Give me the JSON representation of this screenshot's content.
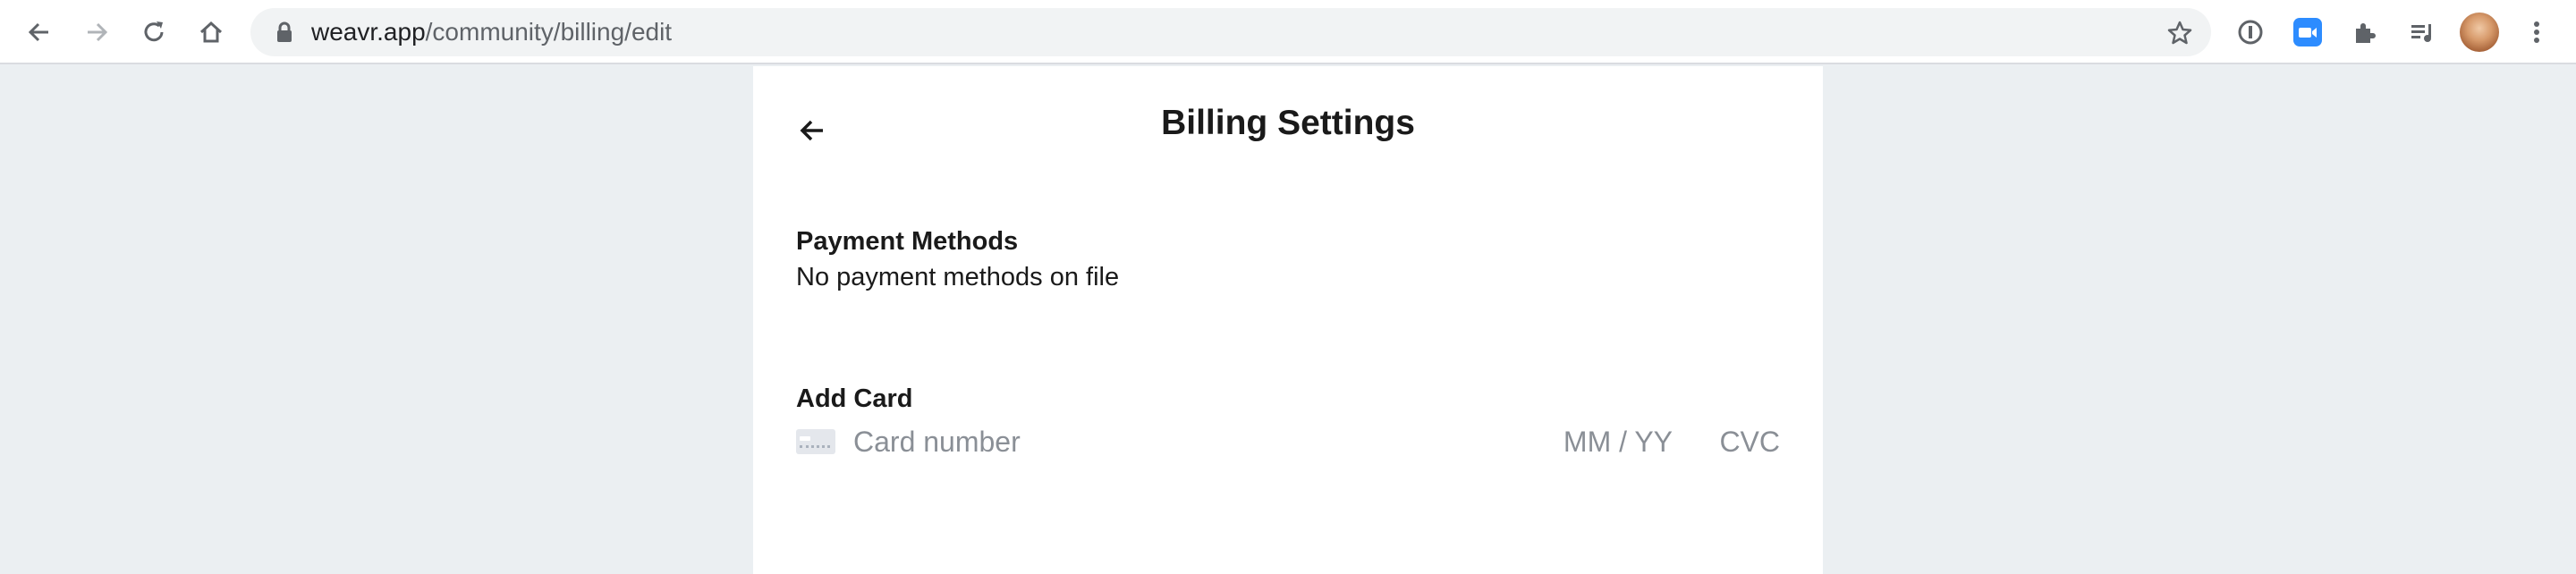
{
  "browser": {
    "url_host": "weavr.app",
    "url_path": "/community/billing/edit",
    "icons": [
      "back-icon",
      "forward-icon",
      "reload-icon",
      "home-icon",
      "lock-icon",
      "star-icon",
      "password-manager-icon",
      "zoom-extension-icon",
      "extensions-icon",
      "media-queue-icon",
      "avatar",
      "menu-icon"
    ]
  },
  "page": {
    "title": "Billing Settings",
    "payment_methods": {
      "heading": "Payment Methods",
      "empty_text": "No payment methods on file"
    },
    "add_card": {
      "heading": "Add Card",
      "card_number_placeholder": "Card number",
      "expiry_placeholder": "MM / YY",
      "cvc_placeholder": "CVC"
    }
  },
  "colors": {
    "background": "#ebeff2",
    "panel": "#ffffff",
    "zoom_blue": "#2d8cff",
    "placeholder": "#8a8f96"
  }
}
